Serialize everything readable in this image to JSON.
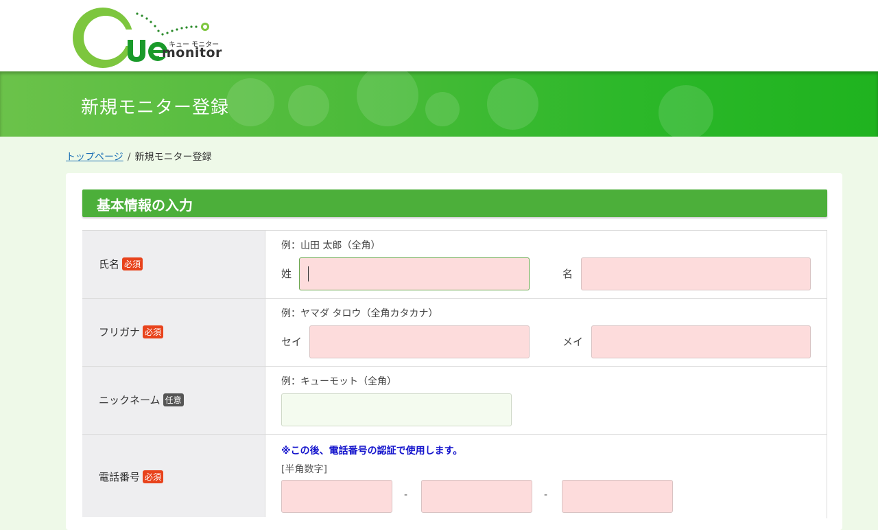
{
  "brand": {
    "logo_jp": "キュー モニター",
    "logo_en": "monitor",
    "green": "#7dc63e",
    "dark_green": "#4caf3a"
  },
  "banner": {
    "title": "新規モニター登録"
  },
  "breadcrumb": {
    "home": "トップページ",
    "separator": "/",
    "current": "新規モニター登録"
  },
  "section": {
    "title": "基本情報の入力"
  },
  "form": {
    "name": {
      "label": "氏名",
      "badge": "必須",
      "hint": "例：山田 太郎（全角）",
      "last_label": "姓",
      "first_label": "名",
      "last_value": "",
      "first_value": ""
    },
    "furigana": {
      "label": "フリガナ",
      "badge": "必須",
      "hint": "例：ヤマダ タロウ（全角カタカナ）",
      "last_label": "セイ",
      "first_label": "メイ"
    },
    "nickname": {
      "label": "ニックネーム",
      "badge": "任意",
      "hint": "例：キューモット（全角）"
    },
    "phone": {
      "label": "電話番号",
      "badge": "必須",
      "note": "※この後、電話番号の認証で使用します。",
      "subhint": "[半角数字]",
      "dash": "-"
    }
  },
  "colors": {
    "required_badge": "#e8431c",
    "optional_badge": "#555555",
    "required_input_bg": "#fddcdc",
    "optional_input_bg": "#f4fbef",
    "note_text": "#1414cc",
    "link": "#1b6fb5"
  }
}
